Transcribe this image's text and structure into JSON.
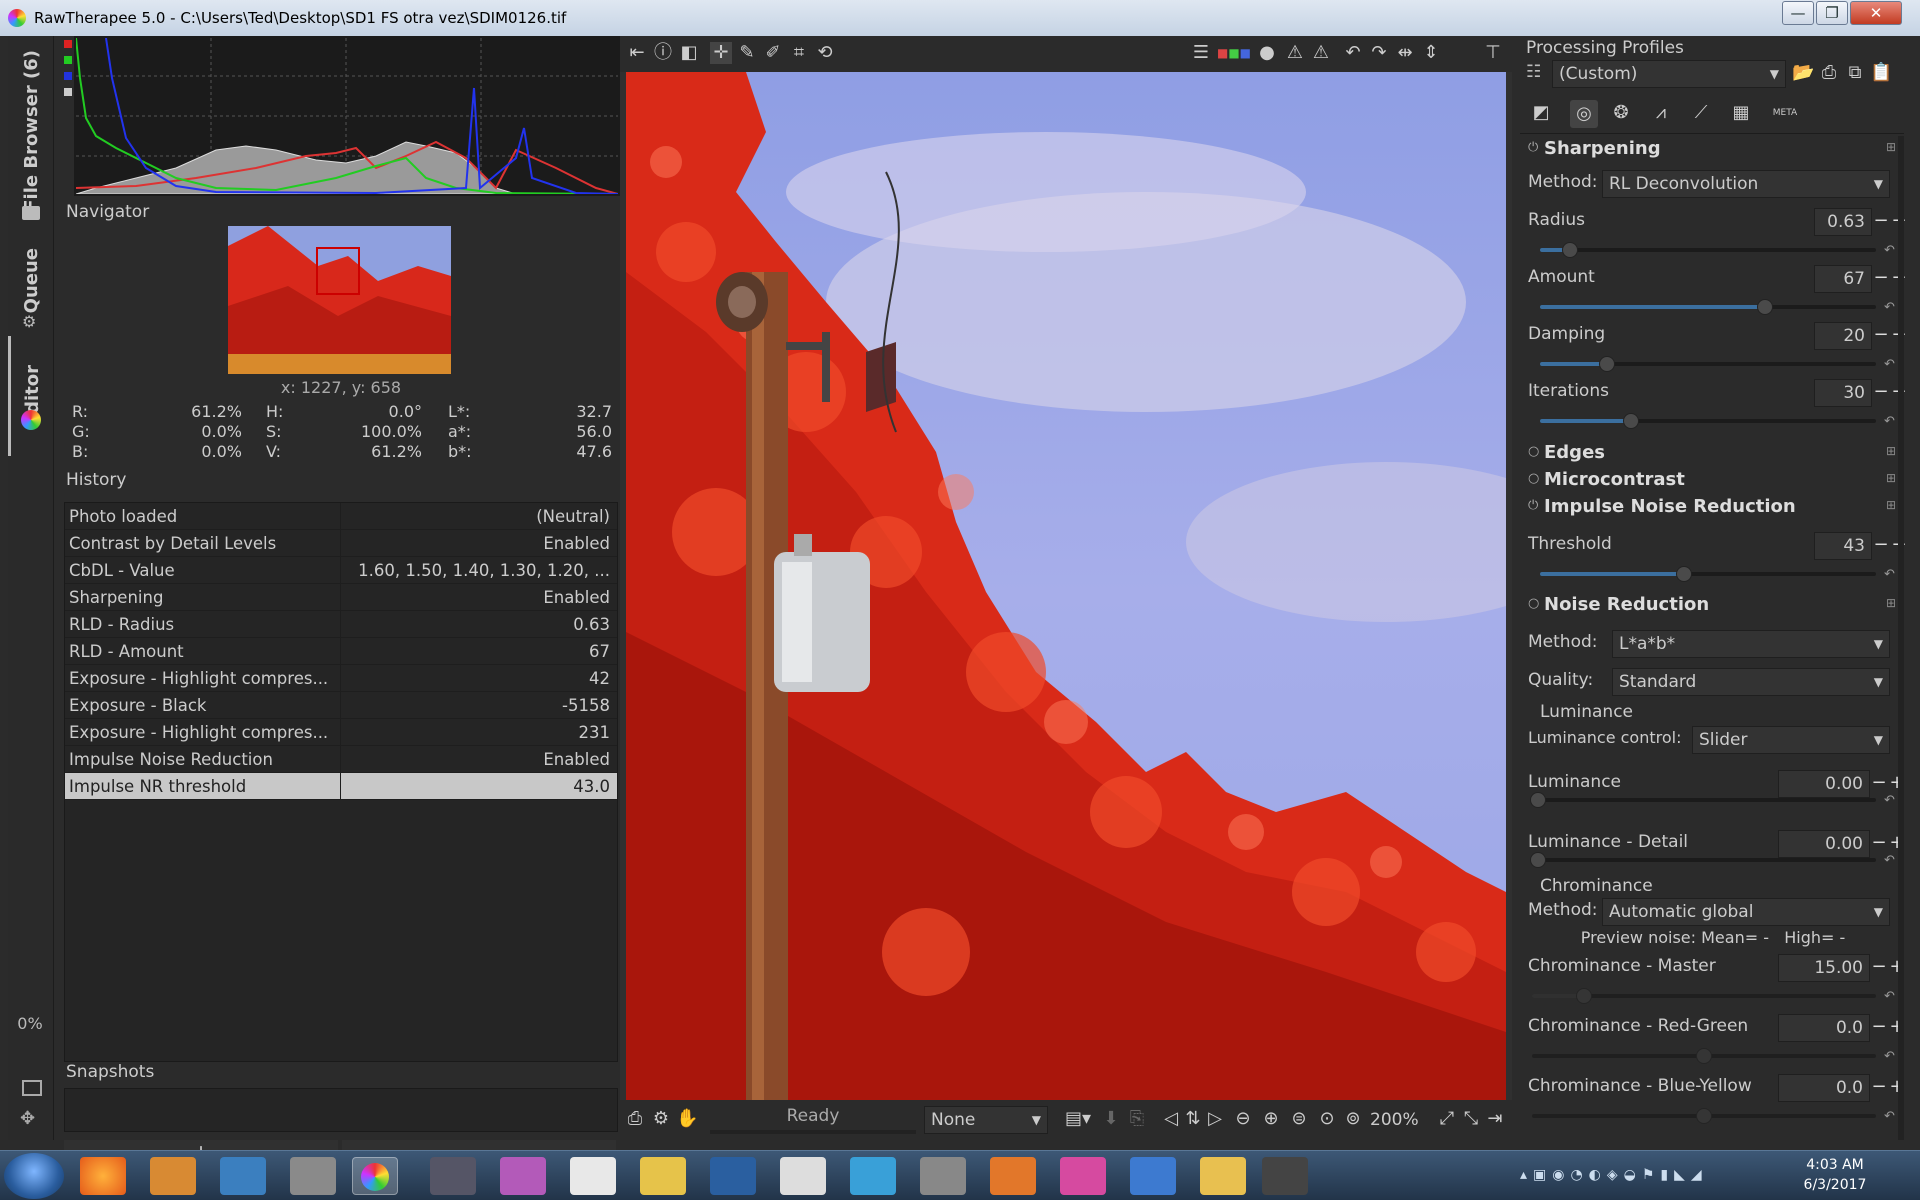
{
  "window": {
    "title": "RawTherapee 5.0 - C:\\Users\\Ted\\Desktop\\SD1 FS otra vez\\SDIM0126.tif",
    "minimize": "—",
    "maximize": "❐",
    "close": "✕"
  },
  "sidetabs": {
    "file_browser": "File Browser (6)",
    "queue": "Queue",
    "editor": "Editor",
    "progress": "0%"
  },
  "navigator": {
    "title": "Navigator",
    "coords": "x: 1227, y: 658",
    "values": {
      "r_label": "R:",
      "r": "61.2%",
      "g_label": "G:",
      "g": "0.0%",
      "b_label": "B:",
      "b": "0.0%",
      "h_label": "H:",
      "h": "0.0°",
      "s_label": "S:",
      "s": "100.0%",
      "v_label": "V:",
      "v": "61.2%",
      "l_label": "L*:",
      "l": "32.7",
      "a_label": "a*:",
      "a": "56.0",
      "bb_label": "b*:",
      "bb": "47.6"
    }
  },
  "history": {
    "title": "History",
    "rows": [
      {
        "name": "Photo loaded",
        "value": "(Neutral)"
      },
      {
        "name": "Contrast by Detail Levels",
        "value": "Enabled"
      },
      {
        "name": "CbDL - Value",
        "value": "1.60, 1.50, 1.40, 1.30, 1.20, ..."
      },
      {
        "name": "Sharpening",
        "value": "Enabled"
      },
      {
        "name": "RLD - Radius",
        "value": "0.63"
      },
      {
        "name": "RLD - Amount",
        "value": "67"
      },
      {
        "name": "Exposure - Highlight compres...",
        "value": "42"
      },
      {
        "name": "Exposure - Black",
        "value": "-5158"
      },
      {
        "name": "Exposure - Highlight compres...",
        "value": "231"
      },
      {
        "name": "Impulse Noise Reduction",
        "value": "Enabled"
      },
      {
        "name": "Impulse NR threshold",
        "value": "43.0"
      }
    ]
  },
  "snapshots": {
    "title": "Snapshots",
    "add": "+",
    "remove": "−"
  },
  "viewer": {
    "status": "Ready",
    "preview_select": "None",
    "zoom": "200%"
  },
  "processing_profiles": {
    "title": "Processing Profiles",
    "selected": "(Custom)"
  },
  "sharpening": {
    "title": "Sharpening",
    "method_label": "Method:",
    "method": "RL Deconvolution",
    "params": [
      {
        "label": "Radius",
        "value": "0.63",
        "level": 0.09
      },
      {
        "label": "Amount",
        "value": "67",
        "level": 0.67
      },
      {
        "label": "Damping",
        "value": "20",
        "level": 0.2
      },
      {
        "label": "Iterations",
        "value": "30",
        "level": 0.27
      }
    ]
  },
  "edges": {
    "title": "Edges"
  },
  "microcontrast": {
    "title": "Microcontrast"
  },
  "impulse_nr": {
    "title": "Impulse Noise Reduction",
    "threshold_label": "Threshold",
    "threshold": "43",
    "level": 0.43
  },
  "noise_reduction": {
    "title": "Noise Reduction",
    "method_label": "Method:",
    "method": "L*a*b*",
    "quality_label": "Quality:",
    "quality": "Standard",
    "luminance_title": "Luminance",
    "lum_control_label": "Luminance control:",
    "lum_control": "Slider",
    "luminance_label": "Luminance",
    "luminance": "0.00",
    "lum_detail_label": "Luminance - Detail",
    "lum_detail": "0.00",
    "chrominance_title": "Chrominance",
    "chroma_method_label": "Method:",
    "chroma_method": "Automatic global",
    "preview_noise": "Preview noise: Mean= -   High= -",
    "chroma_master_label": "Chrominance - Master",
    "chroma_master": "15.00",
    "chroma_master_level": 0.15,
    "chroma_rg_label": "Chrominance - Red-Green",
    "chroma_rg": "0.0",
    "chroma_by_label": "Chrominance - Blue-Yellow",
    "chroma_by": "0.0"
  },
  "taskbar": {
    "time": "4:03 AM",
    "date": "6/3/2017"
  },
  "colors": {
    "accent": "#3b6f9f",
    "selected_row": "#c8c8c8",
    "photo_red": "#e23018",
    "sky": "#9aa7e6"
  }
}
